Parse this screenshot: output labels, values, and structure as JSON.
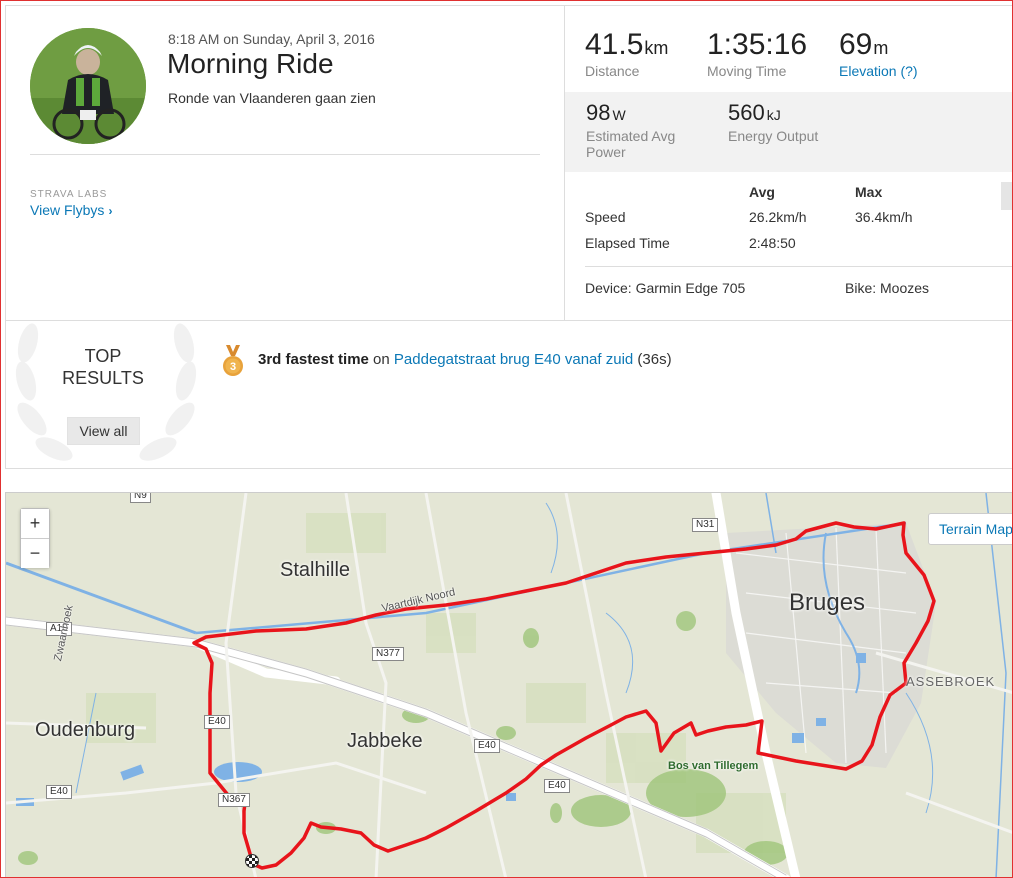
{
  "activity": {
    "datetime": "8:18 AM on Sunday, April 3, 2016",
    "title": "Morning Ride",
    "description": "Ronde van Vlaanderen gaan zien",
    "labs_label": "STRAVA LABS",
    "flybys_label": "View Flybys"
  },
  "stats": {
    "distance": {
      "value": "41.5",
      "unit": "km",
      "label": "Distance"
    },
    "moving_time": {
      "value": "1:35:16",
      "label": "Moving Time"
    },
    "elevation": {
      "value": "69",
      "unit": "m",
      "label": "Elevation (?)"
    },
    "power": {
      "value": "98",
      "unit": "W",
      "label_line1": "Estimated Avg",
      "label_line2": "Power"
    },
    "energy": {
      "value": "560",
      "unit": "kJ",
      "label": "Energy Output"
    }
  },
  "more_stats": {
    "col_avg": "Avg",
    "col_max": "Max",
    "rows": [
      {
        "label": "Speed",
        "avg": "26.2km/h",
        "max": "36.4km/h"
      },
      {
        "label": "Elapsed Time",
        "avg": "2:48:50",
        "max": ""
      }
    ],
    "device": "Device: Garmin Edge 705",
    "bike": "Bike: Moozes"
  },
  "results": {
    "heading_line1": "TOP",
    "heading_line2": "RESULTS",
    "view_all_label": "View all",
    "medal_rank": "3",
    "achievement_bold": "3rd fastest time",
    "achievement_on": " on ",
    "segment_name": "Paddegatstraat brug E40 vanaf zuid",
    "segment_time": " (36s)"
  },
  "map": {
    "zoom_in": "+",
    "zoom_out": "−",
    "terrain_label": "Terrain Map",
    "places": {
      "stalhille": "Stalhille",
      "bruges": "Bruges",
      "oudenburg": "Oudenburg",
      "jabbeke": "Jabbeke",
      "assebroek": "ASSEBROEK",
      "bos": "Bos van Tillegem"
    },
    "roads": {
      "n9": "N9",
      "n31": "N31",
      "a10": "A10",
      "n377": "N377",
      "e40_a": "E40",
      "e40_b": "E40",
      "e40_c": "E40",
      "e40_d": "E40",
      "n367": "N367"
    },
    "streets": {
      "vaartdijk": "Vaartdijk Noord",
      "zwaanhoek": "Zwaanhoek"
    },
    "route_color": "#e8141b"
  }
}
